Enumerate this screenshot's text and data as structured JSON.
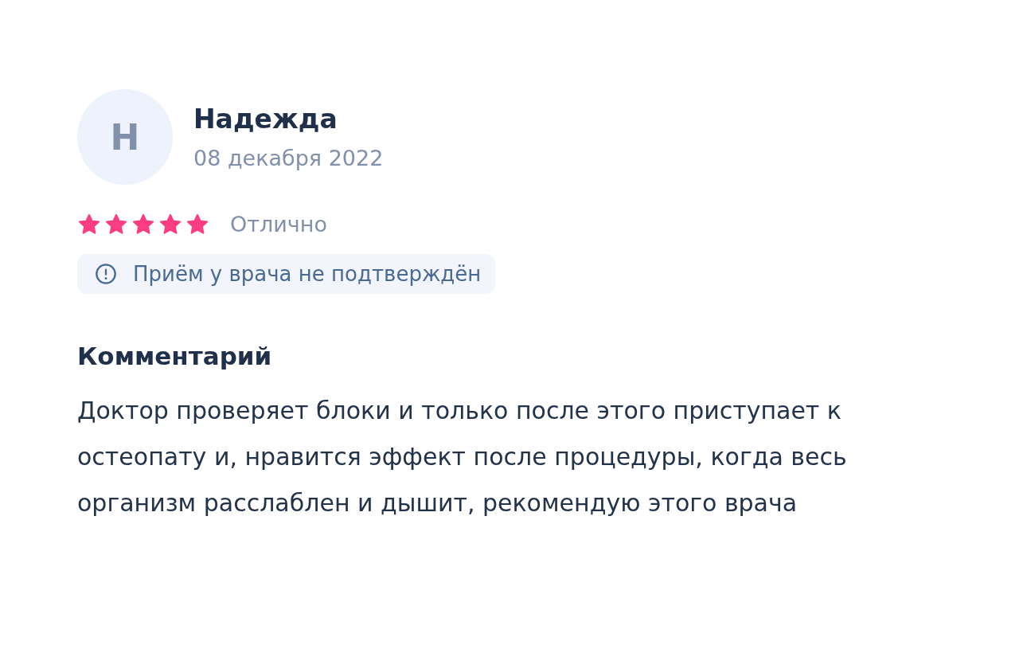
{
  "review": {
    "avatar_letter": "Н",
    "author": "Надежда",
    "date": "08 декабря 2022",
    "stars": 5,
    "rating_label": "Отлично",
    "notice": "Приём у врача не подтверждён",
    "comment_heading": "Комментарий",
    "comment": "Доктор проверяет блоки и только после этого приступает к остеопату и, нравится эффект после процедуры, когда весь организм расслаблен и дышит, рекомендую этого врача"
  }
}
